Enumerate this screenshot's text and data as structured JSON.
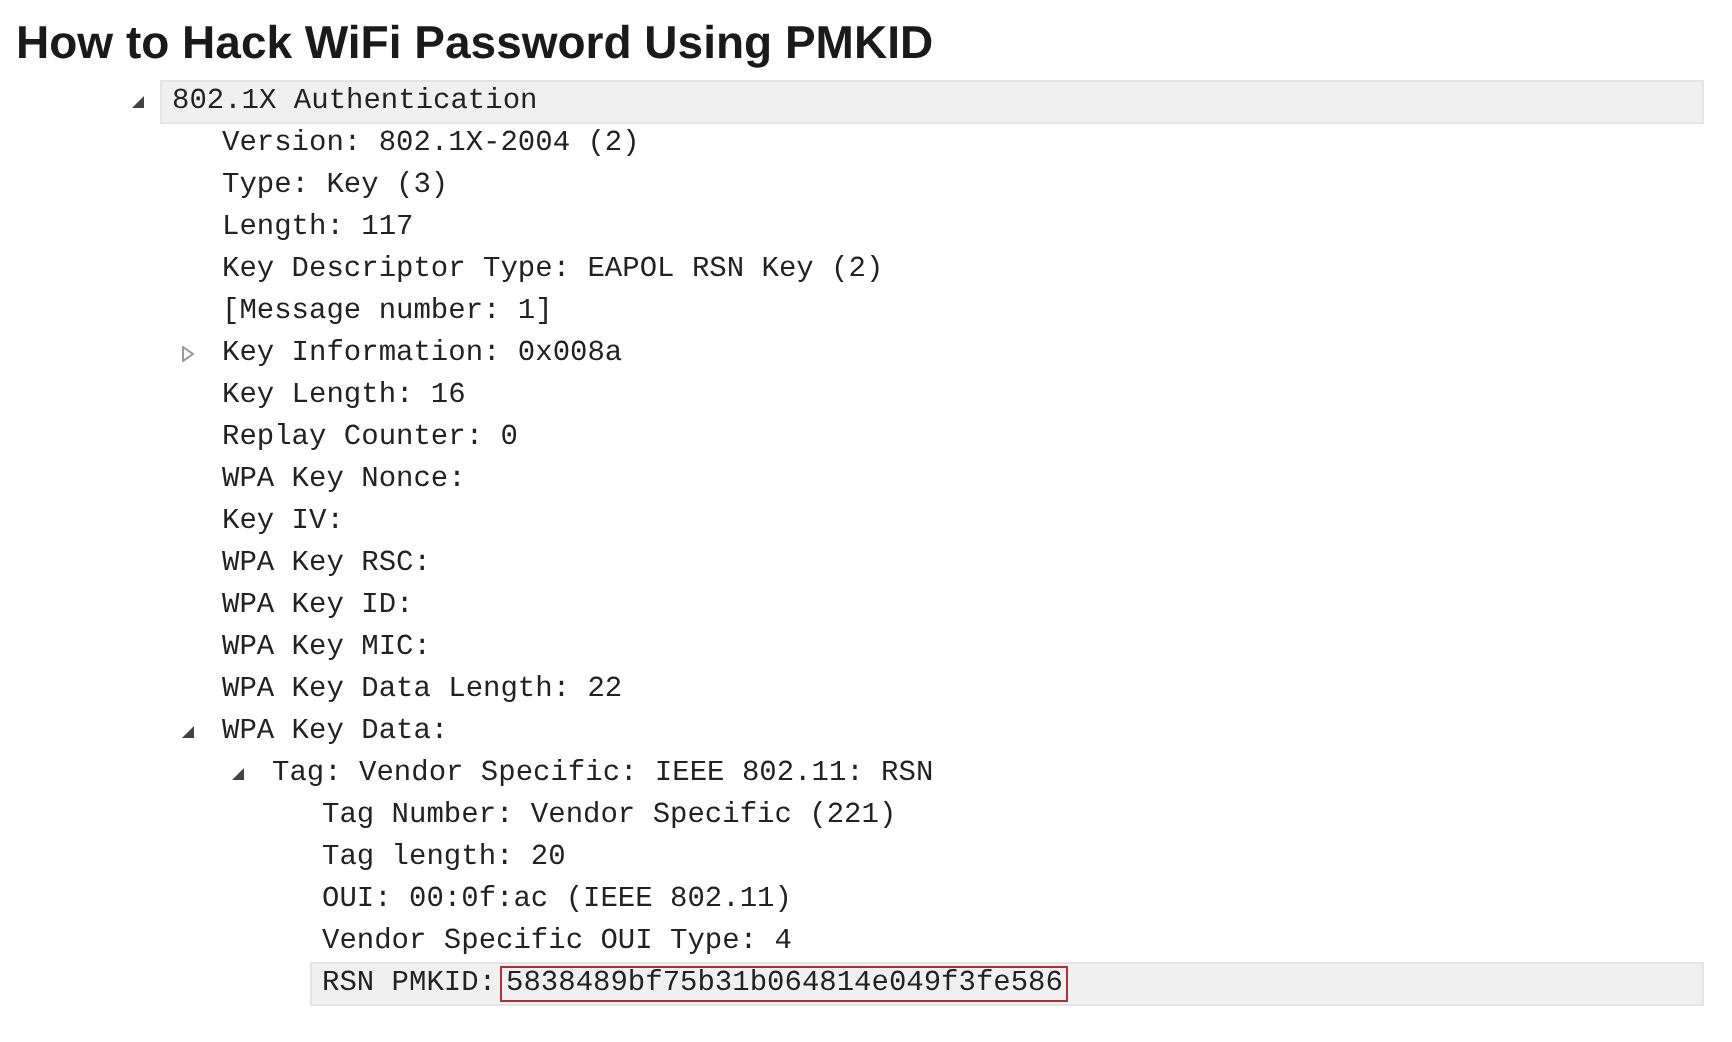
{
  "title": "How to Hack WiFi Password Using PMKID",
  "tree": [
    {
      "text": "802.1X Authentication",
      "expanded": true,
      "selected": true,
      "children": [
        {
          "text": "Version: 802.1X-2004 (2)",
          "selected": false
        },
        {
          "text": "Type: Key (3)",
          "selected": false
        },
        {
          "text": "Length: 117",
          "selected": false
        },
        {
          "text": "Key Descriptor Type: EAPOL RSN Key (2)",
          "selected": false
        },
        {
          "text": "[Message number: 1]",
          "selected": false
        },
        {
          "text": "Key Information: 0x008a",
          "expanded": false,
          "selected": false
        },
        {
          "text": "Key Length: 16",
          "selected": false
        },
        {
          "text": "Replay Counter: 0",
          "selected": false
        },
        {
          "text": "WPA Key Nonce:",
          "selected": false
        },
        {
          "text": "Key IV:",
          "selected": false
        },
        {
          "text": "WPA Key RSC:",
          "selected": false
        },
        {
          "text": "WPA Key ID:",
          "selected": false
        },
        {
          "text": "WPA Key MIC:",
          "selected": false
        },
        {
          "text": "WPA Key Data Length: 22",
          "selected": false
        },
        {
          "text": "WPA Key Data:",
          "expanded": true,
          "selected": false,
          "children": [
            {
              "text": "Tag: Vendor Specific: IEEE 802.11: RSN",
              "expanded": true,
              "selected": false,
              "children": [
                {
                  "text": "Tag Number: Vendor Specific (221)",
                  "selected": false
                },
                {
                  "text": "Tag length: 20",
                  "selected": false
                },
                {
                  "text": "OUI: 00:0f:ac (IEEE 802.11)",
                  "selected": false
                },
                {
                  "text": "Vendor Specific OUI Type: 4",
                  "selected": false
                },
                {
                  "text": "RSN PMKID:",
                  "boxed_value": "5838489bf75b31b064814e049f3fe586",
                  "selected": true
                }
              ]
            }
          ]
        }
      ]
    }
  ]
}
